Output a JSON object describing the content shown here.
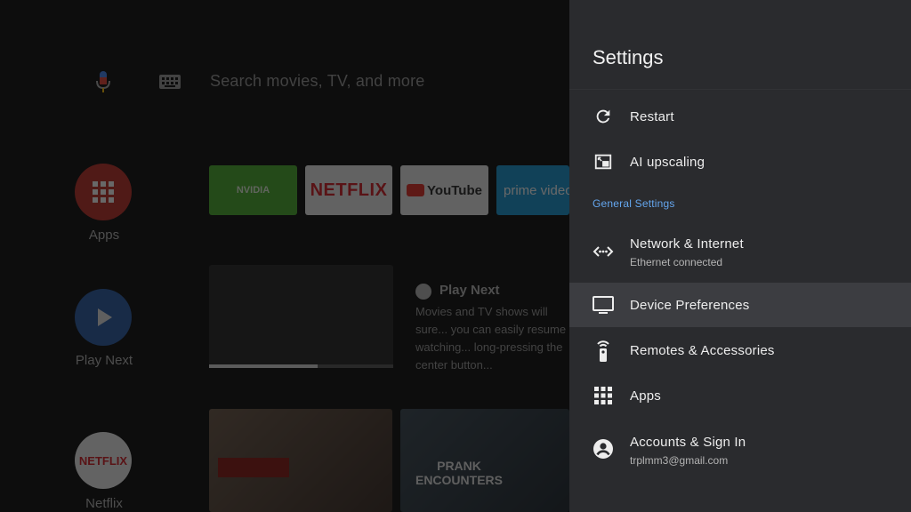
{
  "home": {
    "search_placeholder": "Search movies, TV, and more",
    "side_apps": [
      {
        "label": "Apps"
      },
      {
        "label": "Play Next"
      },
      {
        "label": "Netflix"
      }
    ],
    "tiles": [
      {
        "label": "NVIDIA"
      },
      {
        "label": "NETFLIX"
      },
      {
        "label": "YouTube"
      },
      {
        "label": "prime video"
      }
    ],
    "play_next": {
      "title": "Play Next",
      "description": "Movies and TV shows will sure... you can easily resume watching... long-pressing the center button...",
      "progress_fraction": 0.59
    },
    "thumbs": [
      {
        "label": ""
      },
      {
        "label": "PRANK ENCOUNTERS"
      }
    ]
  },
  "settings": {
    "title": "Settings",
    "items": [
      {
        "label": "Restart",
        "icon": "restart-icon"
      },
      {
        "label": "AI upscaling",
        "icon": "picture-in-picture-icon"
      }
    ],
    "section_label": "General Settings",
    "general_items": [
      {
        "label": "Network & Internet",
        "sub": "Ethernet connected",
        "icon": "network-icon"
      },
      {
        "label": "Device Preferences",
        "icon": "tv-icon",
        "focused": true
      },
      {
        "label": "Remotes & Accessories",
        "icon": "remote-icon"
      },
      {
        "label": "Apps",
        "icon": "apps-grid-icon"
      },
      {
        "label": "Accounts & Sign In",
        "sub": "trplmm3@gmail.com",
        "icon": "account-icon"
      }
    ]
  },
  "colors": {
    "panel_bg": "#2a2b2e",
    "focus_bg": "#3c3d41",
    "section_accent": "#64a6ee"
  }
}
